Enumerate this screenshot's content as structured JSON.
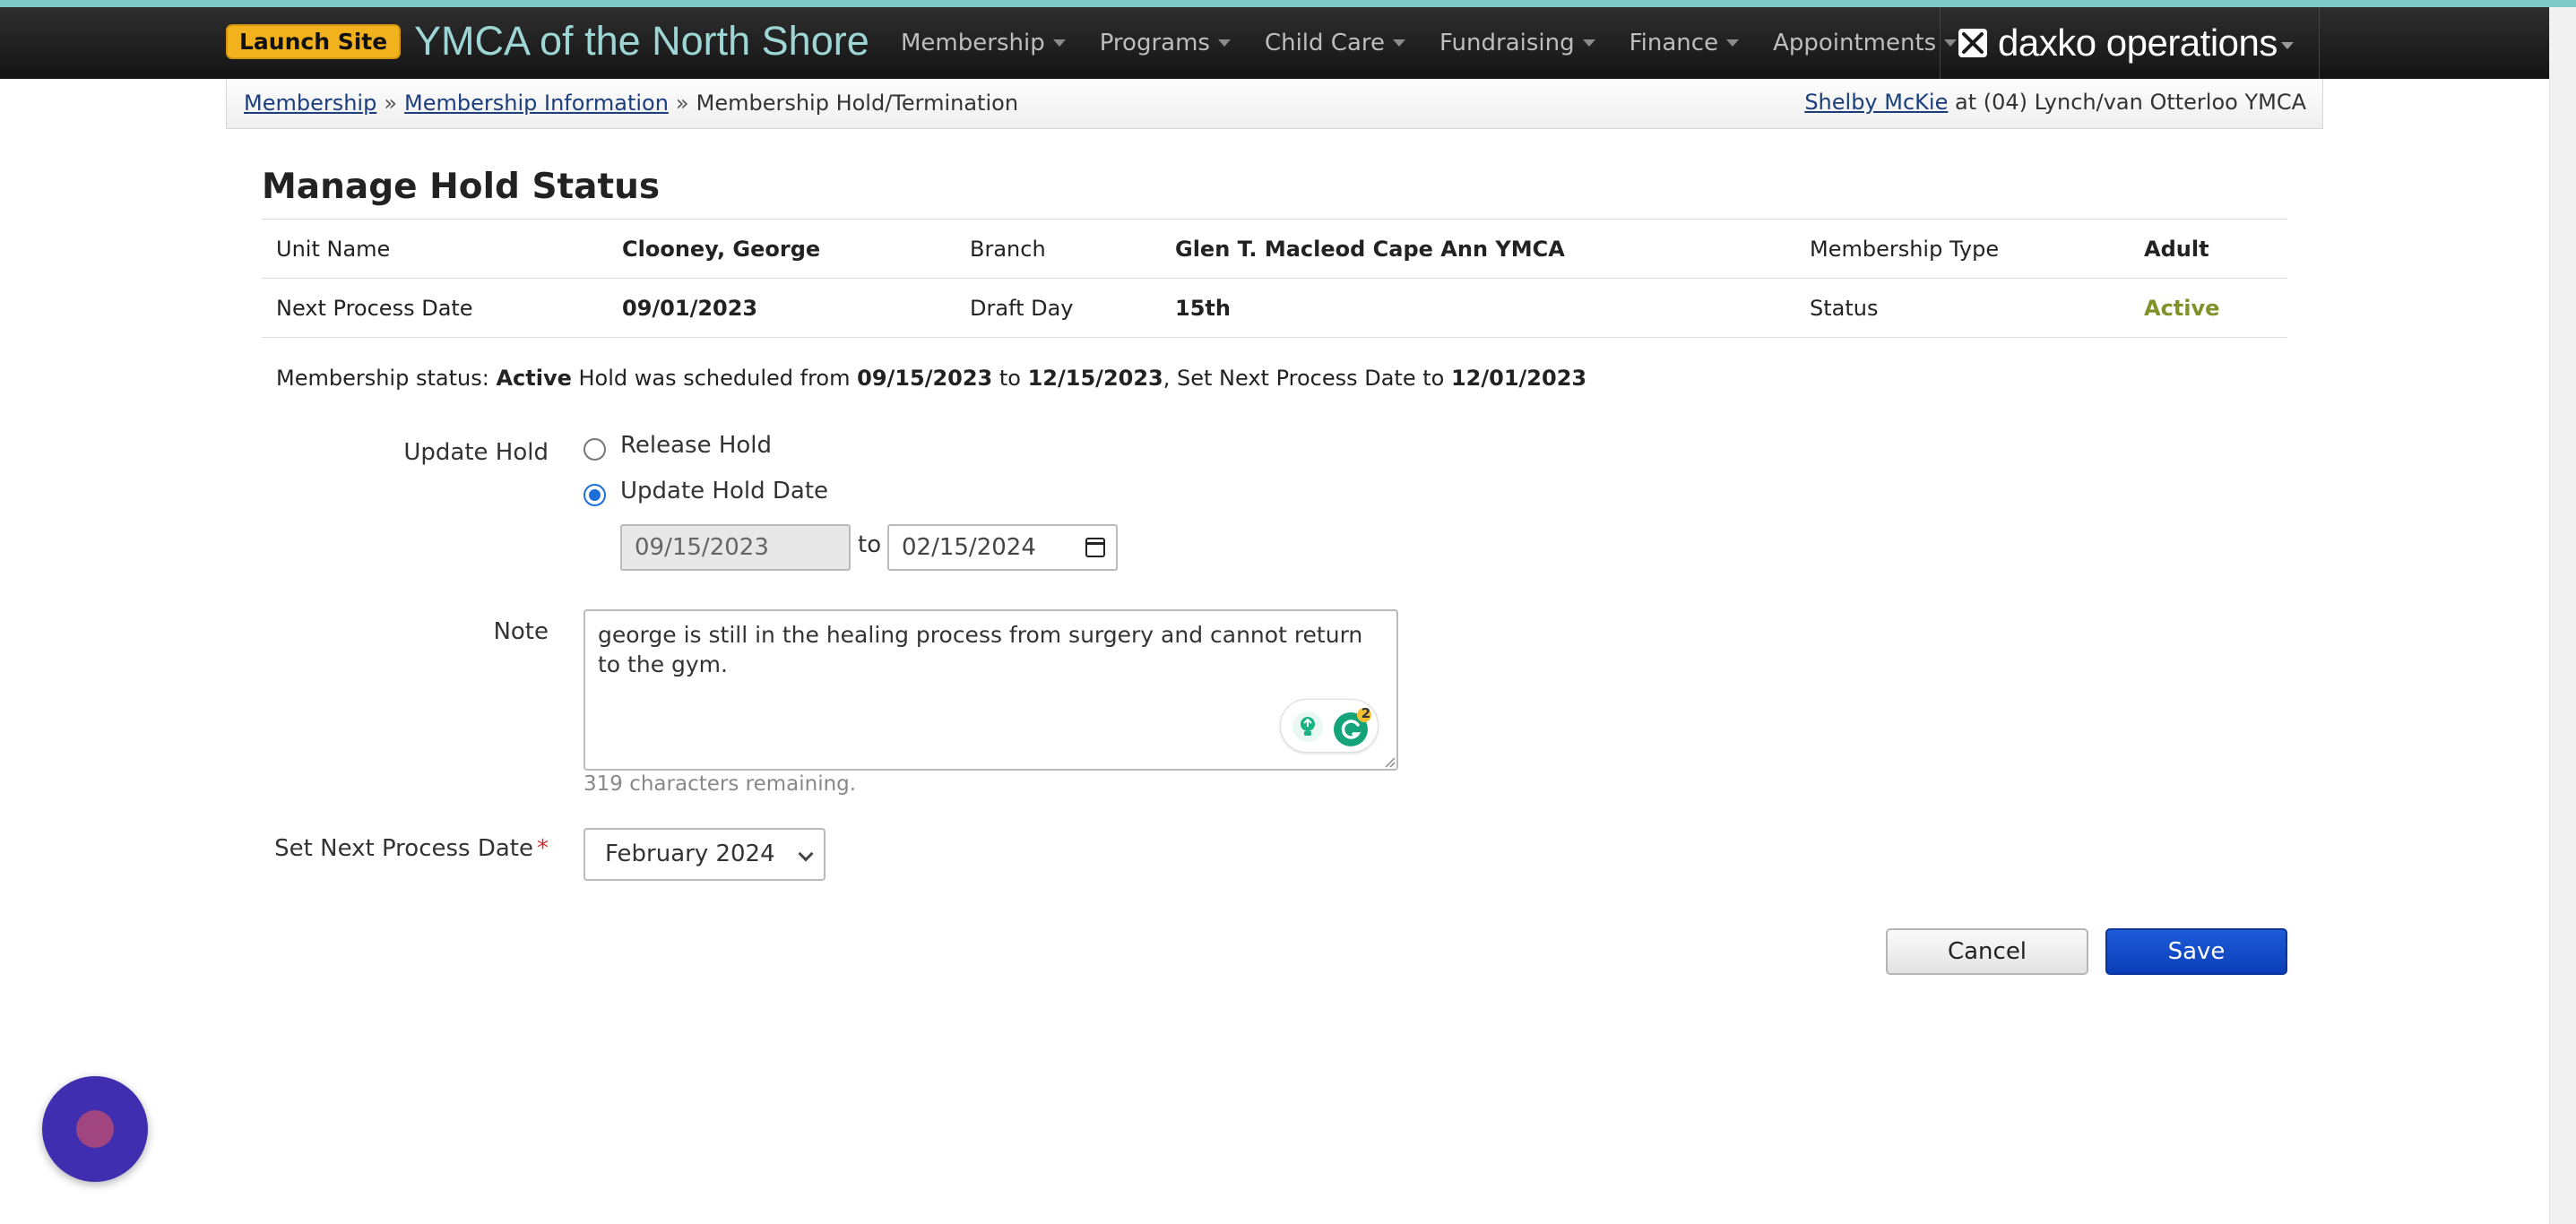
{
  "header": {
    "launch_label": "Launch Site",
    "brand": "YMCA of the North Shore",
    "nav": [
      {
        "label": "Membership"
      },
      {
        "label": "Programs"
      },
      {
        "label": "Child Care"
      },
      {
        "label": "Fundraising"
      },
      {
        "label": "Finance"
      },
      {
        "label": "Appointments"
      }
    ],
    "product": "daxko operations",
    "product_icon": "daxko-logo-icon"
  },
  "breadcrumb": {
    "items": [
      "Membership",
      "Membership Information"
    ],
    "current": "Membership Hold/Termination",
    "separator": "»"
  },
  "user": {
    "name": "Shelby McKie",
    "location": "at (04) Lynch/van Otterloo YMCA"
  },
  "page": {
    "title": "Manage Hold Status"
  },
  "info": {
    "row1": {
      "unit_label": "Unit Name",
      "unit_value": "Clooney, George",
      "branch_label": "Branch",
      "branch_value": "Glen T. Macleod Cape Ann YMCA",
      "type_label": "Membership Type",
      "type_value": "Adult"
    },
    "row2": {
      "next_label": "Next Process Date",
      "next_value": "09/01/2023",
      "draft_label": "Draft Day",
      "draft_value": "15th",
      "status_label": "Status",
      "status_value": "Active"
    },
    "status_color": "#7f9128"
  },
  "status_line": {
    "prefix": "Membership status: ",
    "status": "Active",
    "mid1": " Hold was scheduled from ",
    "from": "09/15/2023",
    "mid2": " to ",
    "to": "12/15/2023",
    "mid3": ", Set Next Process Date to ",
    "next": "12/01/2023"
  },
  "form": {
    "update_hold_label": "Update Hold",
    "release_label": "Release Hold",
    "update_date_label": "Update Hold Date",
    "selected_option": "Update Hold Date",
    "start_date": "09/15/2023",
    "to_label": "to",
    "end_date": "02/15/2024",
    "note_label": "Note",
    "note_value": "george is still in the healing process from surgery and cannot return to the gym.",
    "helper_badge": "2",
    "chars_remaining": "319 characters remaining.",
    "next_date_label": "Set Next Process Date",
    "required_mark": "*",
    "next_date_value": "February 2024"
  },
  "actions": {
    "cancel": "Cancel",
    "save": "Save"
  },
  "colors": {
    "accent": "#9dd6d4",
    "primary": "#0a3eb8",
    "launch": "#f2b21e",
    "chat": "#3f2fb0"
  }
}
